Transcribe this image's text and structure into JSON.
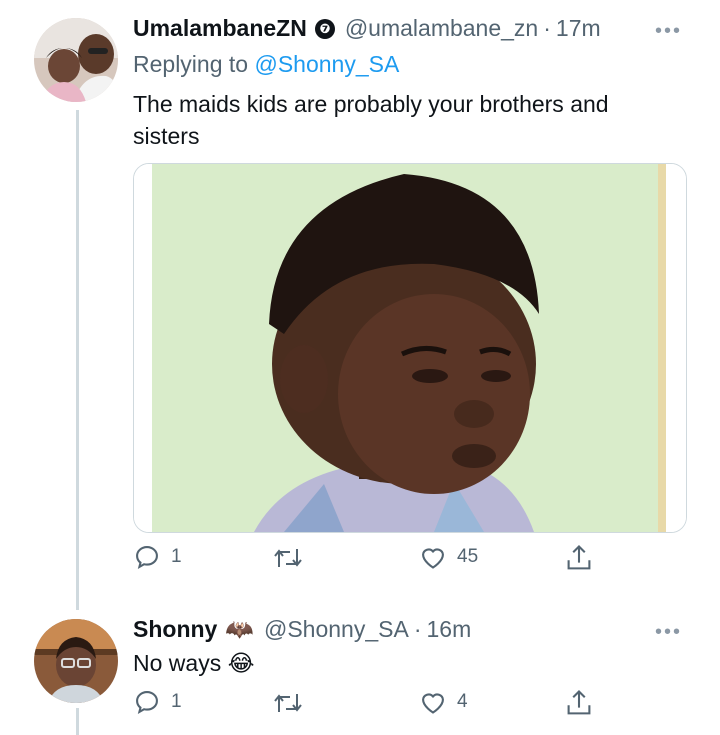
{
  "tweets": [
    {
      "display_name": "UmalambaneZN",
      "verified_badge": "❼",
      "handle": "@umalambane_zn",
      "dot": "·",
      "time": "17m",
      "replying_prefix": "Replying to",
      "replying_to": "@Shonny_SA",
      "text": "The maids kids are probably your brothers and sisters",
      "has_media": true,
      "replies": "1",
      "retweets": "",
      "likes": "45",
      "more_icon": "more-horizontal-icon"
    },
    {
      "display_name": "Shonny",
      "name_emoji": "🦇",
      "handle": "@Shonny_SA",
      "dot": "·",
      "time": "16m",
      "text": "No ways",
      "text_emoji": "😂",
      "replies": "1",
      "retweets": "",
      "likes": "4",
      "more_icon": "more-horizontal-icon"
    }
  ],
  "colors": {
    "text_primary": "#0f1419",
    "text_secondary": "#536471",
    "link": "#1d9bf0",
    "thread_line": "#cfd9de"
  },
  "icons": {
    "reply": "reply-icon",
    "retweet": "retweet-icon",
    "like": "heart-icon",
    "share": "share-icon"
  }
}
